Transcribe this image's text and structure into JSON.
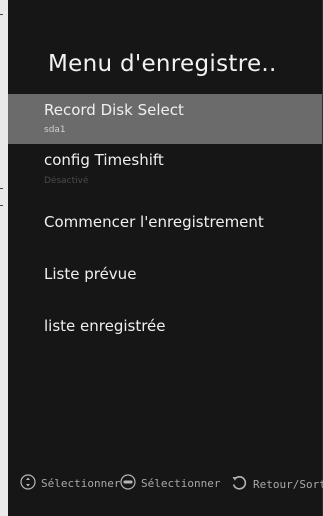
{
  "menu": {
    "title": "Menu d'enregistre..",
    "items": [
      {
        "label": "Record Disk Select",
        "sub": "sda1"
      },
      {
        "label": "config Timeshift",
        "sub": "Désactivé"
      },
      {
        "label": "Commencer l'enregistrement"
      },
      {
        "label": "Liste prévue"
      },
      {
        "label": "liste enregistrée"
      }
    ]
  },
  "footer": {
    "hints": [
      {
        "icon": "dpad-icon",
        "label": "Sélectionner"
      },
      {
        "icon": "enter-button-icon",
        "label": "Sélectionner"
      },
      {
        "icon": "back-arrow-icon",
        "label": "Retour/Sortie"
      }
    ]
  },
  "colors": {
    "background": "#161616",
    "selected_row": "#6b6b6b",
    "text": "#f0f0f0",
    "hint_text": "#a8a8a8"
  }
}
